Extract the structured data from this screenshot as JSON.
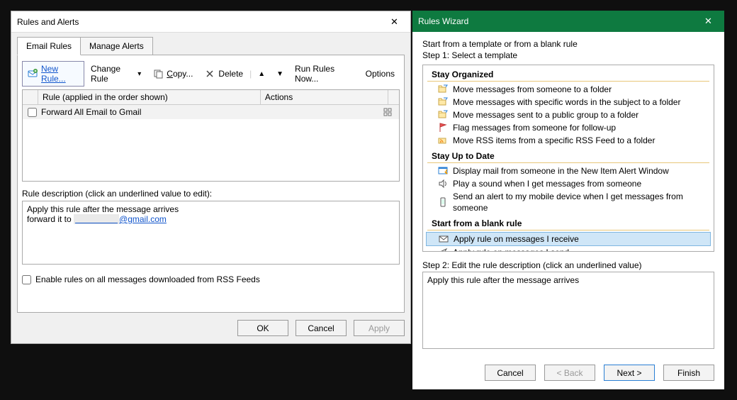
{
  "rules_dialog": {
    "title": "Rules and Alerts",
    "tabs": {
      "email_rules": "Email Rules",
      "manage_alerts": "Manage Alerts"
    },
    "toolbar": {
      "new_rule": "New Rule...",
      "change_rule": "Change Rule",
      "copy": "Copy...",
      "delete": "Delete",
      "run_rules": "Run Rules Now...",
      "options": "Options"
    },
    "list": {
      "header_rule": "Rule (applied in the order shown)",
      "header_actions": "Actions",
      "rows": [
        {
          "name": "Forward All Email to Gmail"
        }
      ]
    },
    "desc_label": "Rule description (click an underlined value to edit):",
    "desc_line1": "Apply this rule after the message arrives",
    "desc_line2_prefix": "forward it to ",
    "desc_line2_link_suffix": "@gmail.com",
    "rss_checkbox": "Enable rules on all messages downloaded from RSS Feeds",
    "buttons": {
      "ok": "OK",
      "cancel": "Cancel",
      "apply": "Apply"
    }
  },
  "wizard": {
    "title": "Rules Wizard",
    "intro": "Start from a template or from a blank rule",
    "step1": "Step 1: Select a template",
    "categories": [
      {
        "title": "Stay Organized",
        "items": [
          {
            "icon": "folder-move-icon",
            "label": "Move messages from someone to a folder"
          },
          {
            "icon": "folder-move-icon",
            "label": "Move messages with specific words in the subject to a folder"
          },
          {
            "icon": "folder-move-icon",
            "label": "Move messages sent to a public group to a folder"
          },
          {
            "icon": "flag-icon",
            "label": "Flag messages from someone for follow-up"
          },
          {
            "icon": "rss-move-icon",
            "label": "Move RSS items from a specific RSS Feed to a folder"
          }
        ]
      },
      {
        "title": "Stay Up to Date",
        "items": [
          {
            "icon": "alert-window-icon",
            "label": "Display mail from someone in the New Item Alert Window"
          },
          {
            "icon": "sound-icon",
            "label": "Play a sound when I get messages from someone"
          },
          {
            "icon": "mobile-icon",
            "label": "Send an alert to my mobile device when I get messages from someone"
          }
        ]
      },
      {
        "title": "Start from a blank rule",
        "items": [
          {
            "icon": "envelope-in-icon",
            "label": "Apply rule on messages I receive",
            "selected": true
          },
          {
            "icon": "envelope-out-icon",
            "label": "Apply rule on messages I send"
          }
        ]
      }
    ],
    "step2_label": "Step 2: Edit the rule description (click an underlined value)",
    "step2_text": "Apply this rule after the message arrives",
    "buttons": {
      "cancel": "Cancel",
      "back": "< Back",
      "next": "Next >",
      "finish": "Finish"
    }
  }
}
